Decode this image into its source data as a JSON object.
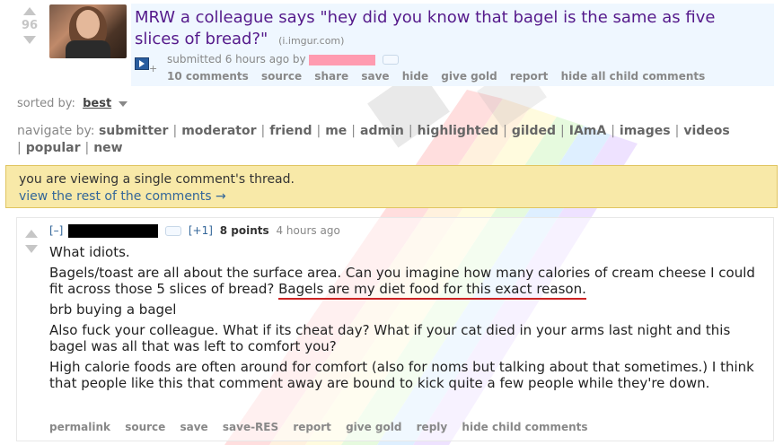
{
  "post": {
    "score": "96",
    "title": "MRW a colleague says \"hey did you know that bagel is the same as five slices of bread?\"",
    "domain": "(i.imgur.com)",
    "submitted": "submitted 6 hours ago by",
    "links": [
      "10 comments",
      "source",
      "share",
      "save",
      "hide",
      "give gold",
      "report",
      "hide all child comments"
    ]
  },
  "sort": {
    "label": "sorted by:",
    "value": "best"
  },
  "navigate": {
    "label": "navigate by:",
    "items": [
      "submitter",
      "moderator",
      "friend",
      "me",
      "admin",
      "highlighted",
      "gilded",
      "IAmA",
      "images",
      "videos",
      "popular",
      "new"
    ]
  },
  "notice": {
    "line1": "you are viewing a single comment's thread.",
    "line2": "view the rest of the comments →"
  },
  "comment": {
    "expand": "[–]",
    "flair": "[+1]",
    "points": "8 points",
    "time": "4 hours ago",
    "paragraphs": {
      "p1": "What idiots.",
      "p2_a": "Bagels/toast are all about the surface area. Can you imagine how many calories of cream cheese I could fit across those 5 slices of bread? ",
      "p2_b": "Bagels are my diet food for this exact reason.",
      "p3": "brb buying a bagel",
      "p4": "Also fuck your colleague. What if its cheat day? What if your cat died in your arms last night and this bagel was all that was left to comfort you?",
      "p5": "High calorie foods are often around for comfort (also for noms but talking about that sometimes.) I think that people like this that comment away are bound to kick quite a few people while they're down."
    },
    "links": [
      "permalink",
      "source",
      "save",
      "save-RES",
      "report",
      "give gold",
      "reply",
      "hide child comments"
    ]
  },
  "colors": {
    "title": "#551a8b",
    "notice_bg": "#f8e9a8",
    "post_bg": "#eff7ff",
    "underline": "#cc2222"
  }
}
